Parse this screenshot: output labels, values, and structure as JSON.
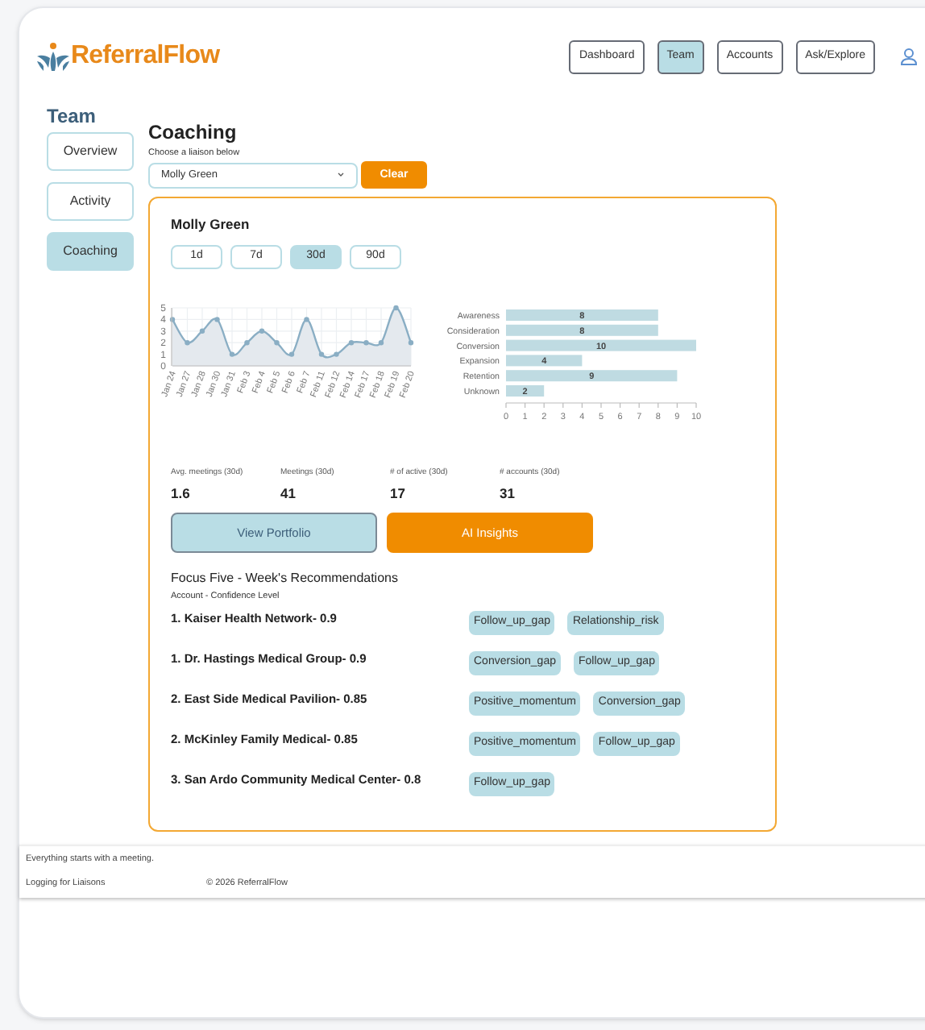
{
  "header": {
    "logo": "ReferralFlow",
    "nav": [
      {
        "label": "Dashboard",
        "selected": false
      },
      {
        "label": "Team",
        "selected": true
      },
      {
        "label": "Accounts",
        "selected": false
      },
      {
        "label": "Ask/Explore",
        "selected": false
      }
    ]
  },
  "sidebar": {
    "title": "Team",
    "items": [
      {
        "label": "Overview",
        "selected": false
      },
      {
        "label": "Activity",
        "selected": false
      },
      {
        "label": "Coaching",
        "selected": true
      }
    ]
  },
  "main": {
    "title": "Coaching",
    "liaison_label": "Choose a liaison below",
    "liaison_select": "Molly Green",
    "clear_button": "Clear",
    "card": {
      "name": "Molly Green",
      "periods": [
        {
          "label": "1d",
          "selected": false
        },
        {
          "label": "7d",
          "selected": false
        },
        {
          "label": "30d",
          "selected": true
        },
        {
          "label": "90d",
          "selected": false
        }
      ],
      "line_chart": {
        "chart_data": {
          "type": "area",
          "x": [
            "Jan 24",
            "Jan 27",
            "Jan 28",
            "Jan 30",
            "Jan 31",
            "Feb 3",
            "Feb 4",
            "Feb 5",
            "Feb 6",
            "Feb 7",
            "Feb 11",
            "Feb 12",
            "Feb 14",
            "Feb 17",
            "Feb 18",
            "Feb 19",
            "Feb 20"
          ],
          "series": [
            {
              "color": "#8aaec4",
              "values": [
                4,
                2,
                3,
                4,
                1,
                2,
                3,
                2,
                1,
                4,
                1,
                1,
                2,
                2,
                2,
                5,
                2
              ]
            }
          ],
          "ylim": [
            0,
            5
          ],
          "yticks": [
            0,
            1,
            2,
            3,
            4,
            5
          ],
          "grid": true
        }
      },
      "bar_chart": {
        "chart_data": {
          "type": "bar",
          "orientation": "horizontal",
          "categories": [
            "Awareness",
            "Consideration",
            "Conversion",
            "Expansion",
            "Retention",
            "Unknown"
          ],
          "series": [
            {
              "color": "#bfdbe2",
              "values": [
                8,
                8,
                10,
                4,
                9,
                2
              ]
            }
          ],
          "xlim": [
            0,
            10
          ],
          "xticks": [
            0,
            1,
            2,
            3,
            4,
            5,
            6,
            7,
            8,
            9,
            10
          ],
          "data_labels": true
        }
      },
      "stats": [
        {
          "label": "Avg. meetings (30d)",
          "value": "1.6"
        },
        {
          "label": "Meetings (30d)",
          "value": "41"
        },
        {
          "label": "# of active (30d)",
          "value": "17"
        },
        {
          "label": "# accounts (30d)",
          "value": "31"
        }
      ],
      "buttons": [
        {
          "label": "View Portfolio",
          "kind": "secondary"
        },
        {
          "label": "AI Insights",
          "kind": "primary"
        }
      ],
      "focus": {
        "title": "Focus Five - Week's Recommendations",
        "subtitle": "Account - Confidence Level",
        "rows": [
          {
            "account": "1. Kaiser Health Network- 0.9",
            "tags": [
              "Follow_up_gap",
              "Relationship_risk"
            ]
          },
          {
            "account": "1. Dr. Hastings Medical Group- 0.9",
            "tags": [
              "Conversion_gap",
              "Follow_up_gap"
            ]
          },
          {
            "account": "2. East Side  Medical Pavilion- 0.85",
            "tags": [
              "Positive_momentum",
              "Conversion_gap"
            ]
          },
          {
            "account": "2. McKinley Family Medical- 0.85",
            "tags": [
              "Positive_momentum",
              "Follow_up_gap"
            ]
          },
          {
            "account": "3. San Ardo Community Medical Center- 0.8",
            "tags": [
              "Follow_up_gap"
            ]
          }
        ]
      }
    }
  },
  "footer": {
    "tagline": "Everything starts with a meeting.",
    "left": "Logging for Liaisons",
    "copyright": "© 2026 ReferralFlow"
  }
}
